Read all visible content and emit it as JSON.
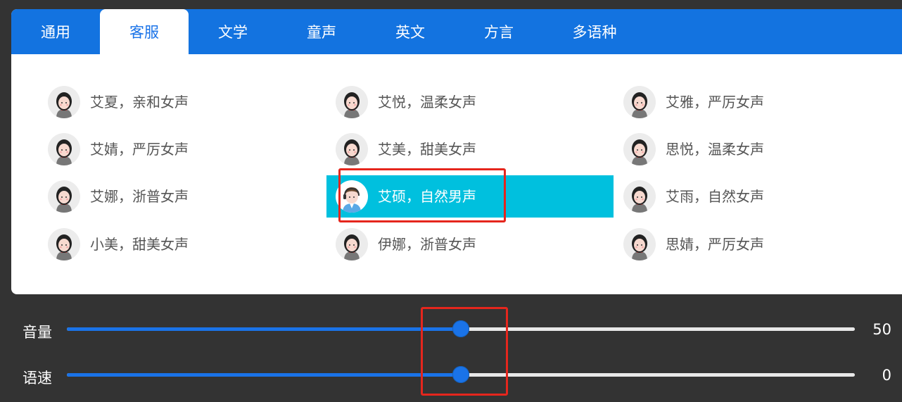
{
  "tabs": [
    {
      "label": "通用",
      "active": false
    },
    {
      "label": "客服",
      "active": true
    },
    {
      "label": "文学",
      "active": false
    },
    {
      "label": "童声",
      "active": false
    },
    {
      "label": "英文",
      "active": false
    },
    {
      "label": "方言",
      "active": false
    },
    {
      "label": "多语种",
      "active": false
    }
  ],
  "voices": [
    [
      "艾夏，亲和女声",
      "艾悦，温柔女声",
      "艾雅，严厉女声"
    ],
    [
      "艾婧，严厉女声",
      "艾美，甜美女声",
      "思悦，温柔女声"
    ],
    [
      "艾娜，浙普女声",
      "艾硕，自然男声",
      "艾雨，自然女声"
    ],
    [
      "小美，甜美女声",
      "伊娜，浙普女声",
      "思婧，严厉女声"
    ]
  ],
  "selected_voice": "艾硕，自然男声",
  "sliders": {
    "volume": {
      "label": "音量",
      "value": "50",
      "fraction": 0.5
    },
    "speed": {
      "label": "语速",
      "value": "0",
      "fraction": 0.5
    }
  },
  "colors": {
    "accent": "#1a73e8",
    "selected": "#00c0de",
    "annotation": "#e5261d"
  }
}
